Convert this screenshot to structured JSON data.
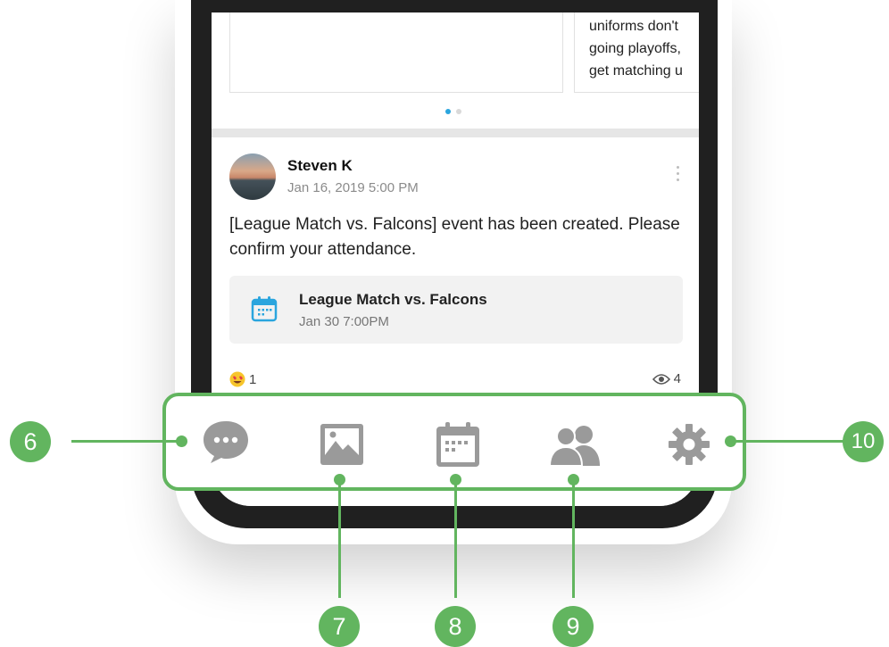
{
  "carousel": {
    "right_card_text": "uniforms don't\ngoing playoffs,\nget matching u",
    "active_index": 0,
    "count": 2
  },
  "post": {
    "author": "Steven K",
    "timestamp": "Jan 16, 2019 5:00 PM",
    "text": "[League Match vs. Falcons] event has been created. Please confirm your attendance.",
    "event": {
      "title": "League Match vs. Falcons",
      "date": "Jan 30 7:00PM"
    },
    "reaction_count": "1",
    "view_count": "4"
  },
  "tabbar": {
    "items": [
      {
        "icon": "chat-bubble-icon",
        "label": "Chat"
      },
      {
        "icon": "photo-icon",
        "label": "Photos"
      },
      {
        "icon": "calendar-icon",
        "label": "Calendar"
      },
      {
        "icon": "members-icon",
        "label": "Members"
      },
      {
        "icon": "gear-icon",
        "label": "Settings"
      }
    ]
  },
  "callouts": [
    "6",
    "7",
    "8",
    "9",
    "10"
  ],
  "colors": {
    "callout_green": "#62b55f",
    "tab_icon_gray": "#9a9a9a",
    "accent_blue": "#2aa5de"
  }
}
